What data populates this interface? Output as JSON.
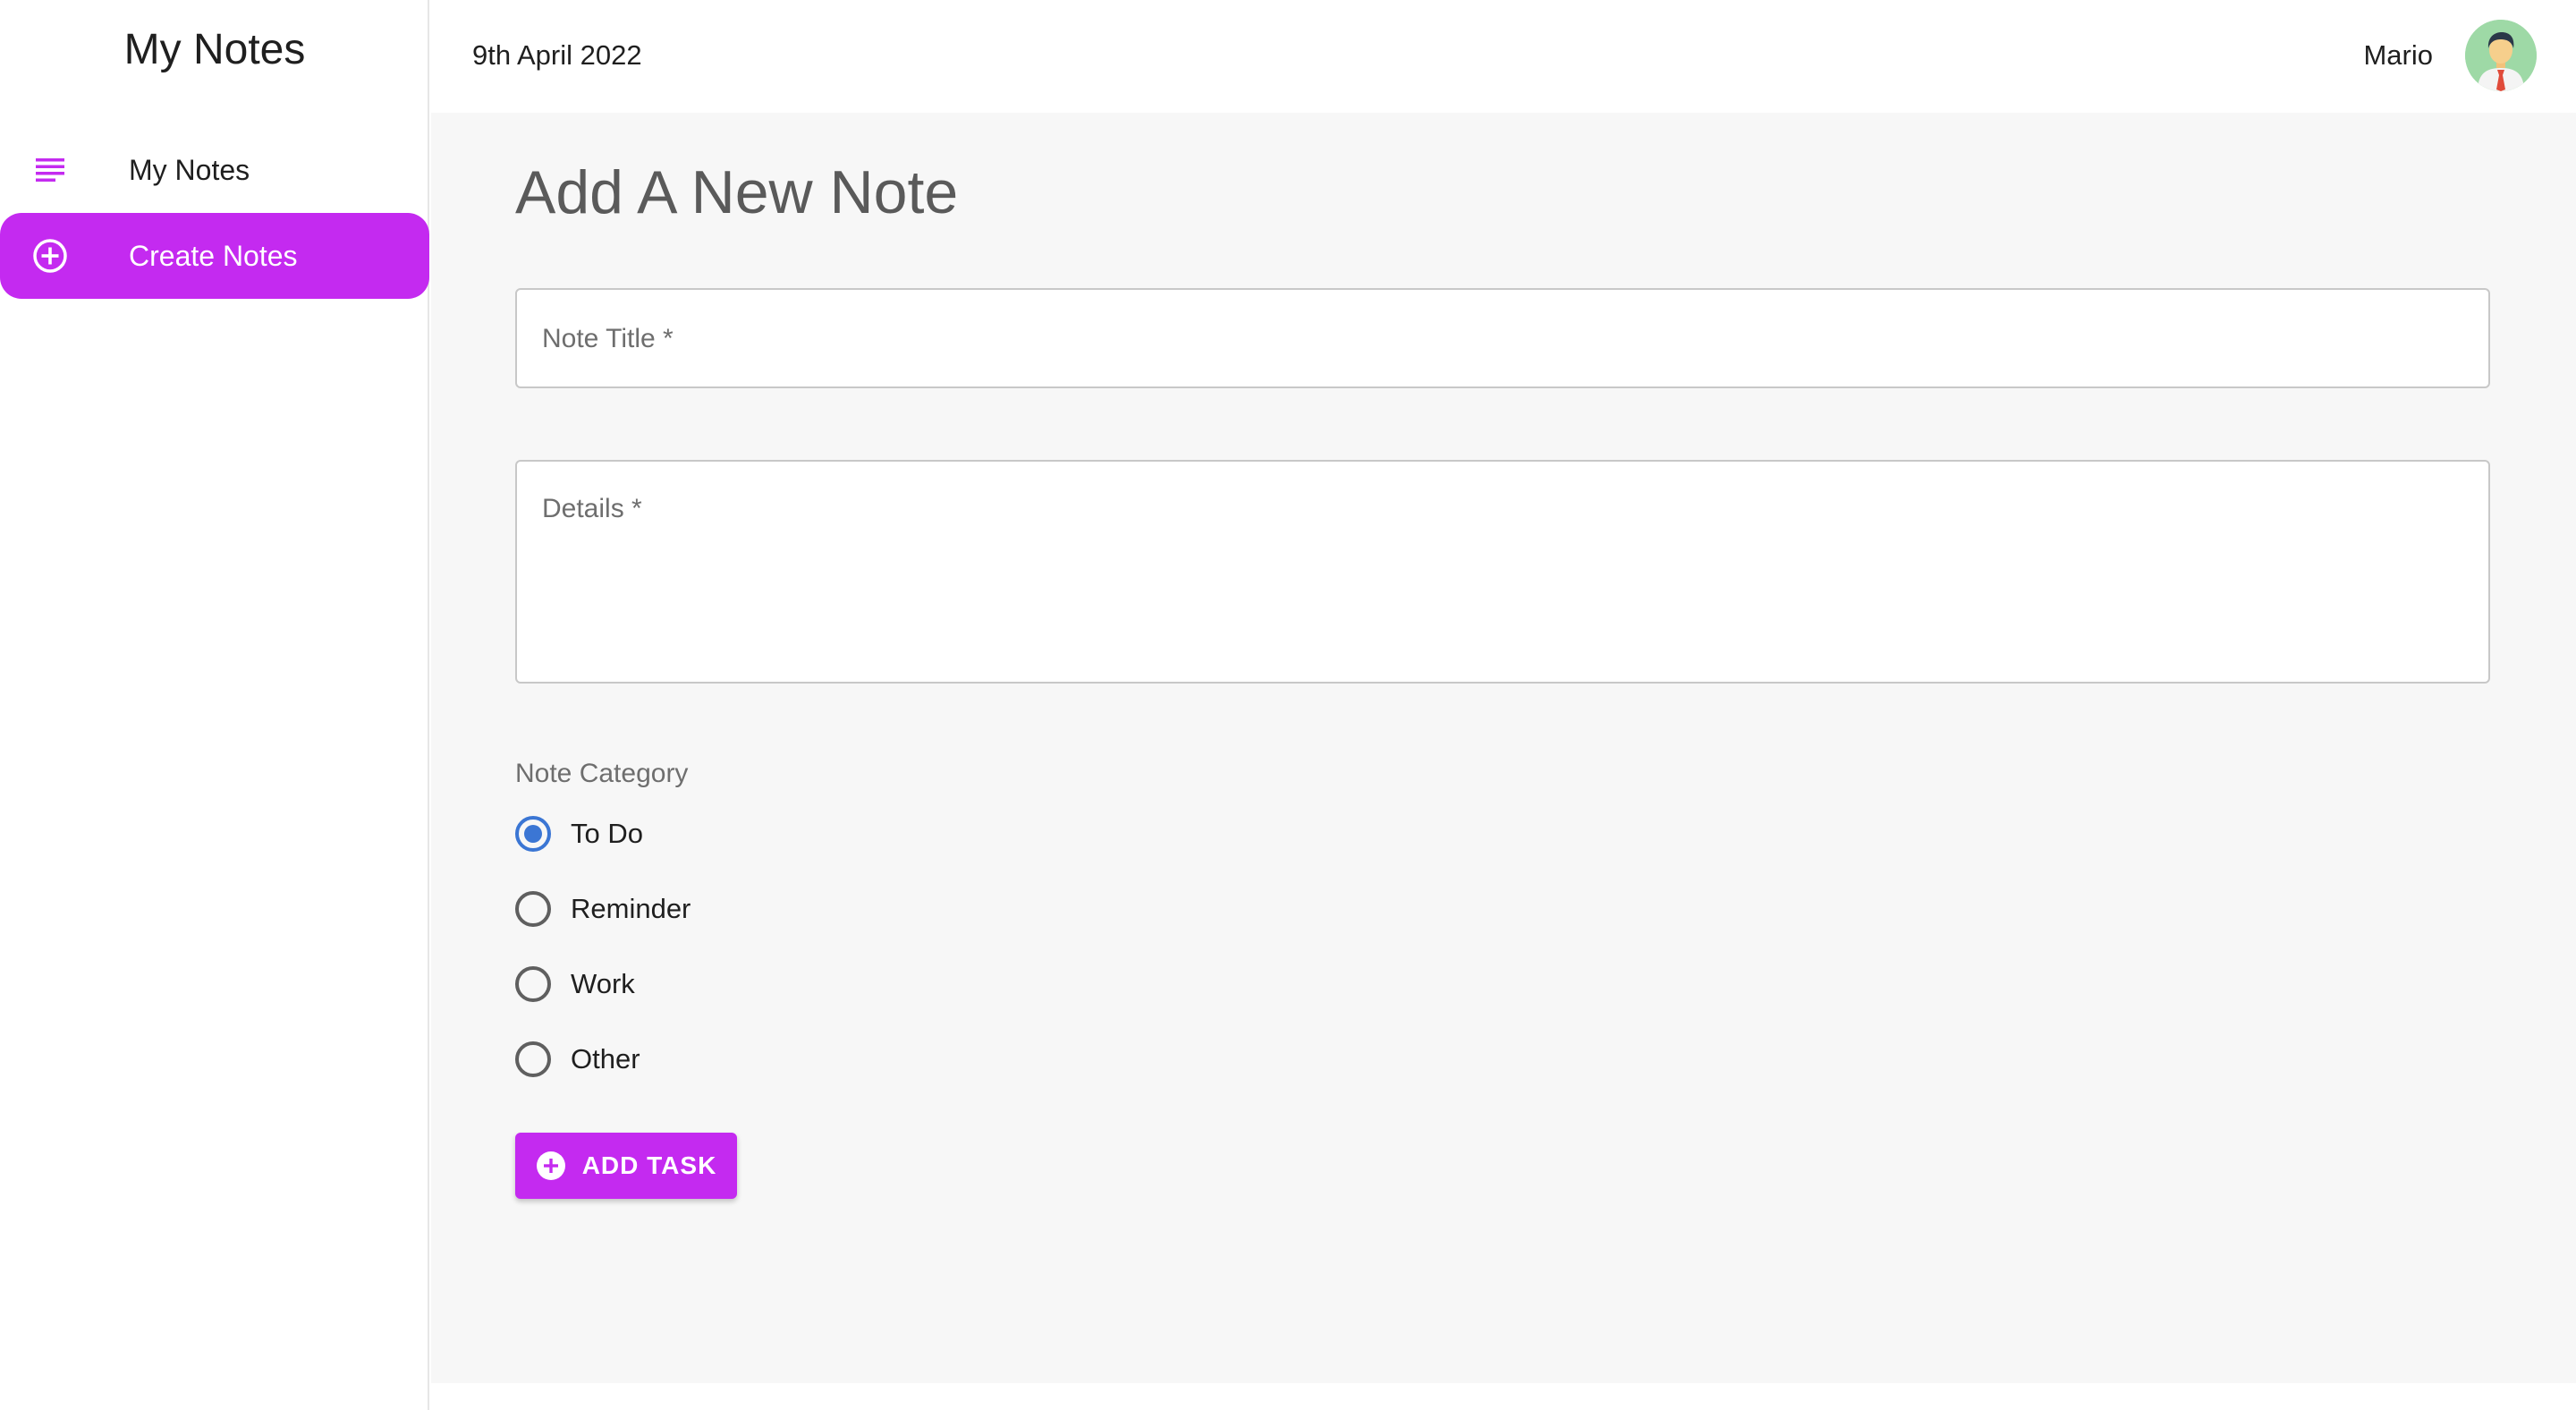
{
  "sidebar": {
    "title": "My Notes",
    "items": [
      {
        "label": "My Notes",
        "icon": "subject-icon",
        "active": false
      },
      {
        "label": "Create Notes",
        "icon": "add-circle-icon",
        "active": true
      }
    ]
  },
  "header": {
    "date": "9th April 2022",
    "user_name": "Mario",
    "avatar_icon": "user-avatar"
  },
  "main": {
    "page_title": "Add A New Note",
    "title_field": {
      "placeholder": "Note Title *",
      "value": ""
    },
    "details_field": {
      "placeholder": "Details *",
      "value": ""
    },
    "category": {
      "label": "Note Category",
      "options": [
        {
          "label": "To Do",
          "checked": true
        },
        {
          "label": "Reminder",
          "checked": false
        },
        {
          "label": "Work",
          "checked": false
        },
        {
          "label": "Other",
          "checked": false
        }
      ]
    },
    "add_button": {
      "label": "ADD TASK",
      "icon": "add-circle-icon"
    }
  },
  "colors": {
    "accent": "#c42af0",
    "radio_selected": "#3b76d4",
    "main_background": "#f7f7f7"
  }
}
